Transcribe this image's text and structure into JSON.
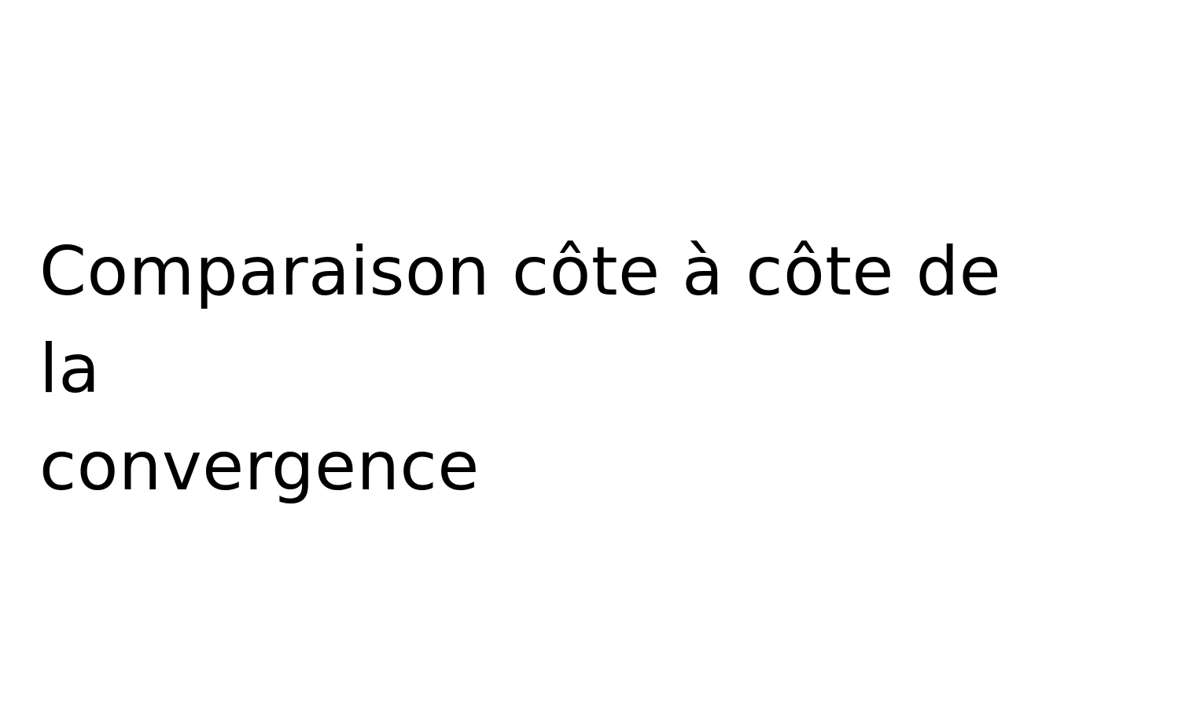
{
  "slide": {
    "title_line1": "Comparaison côte à côte de la",
    "title_line2": "convergence"
  },
  "colors": {
    "background": "#ffffff",
    "text": "#000000"
  }
}
